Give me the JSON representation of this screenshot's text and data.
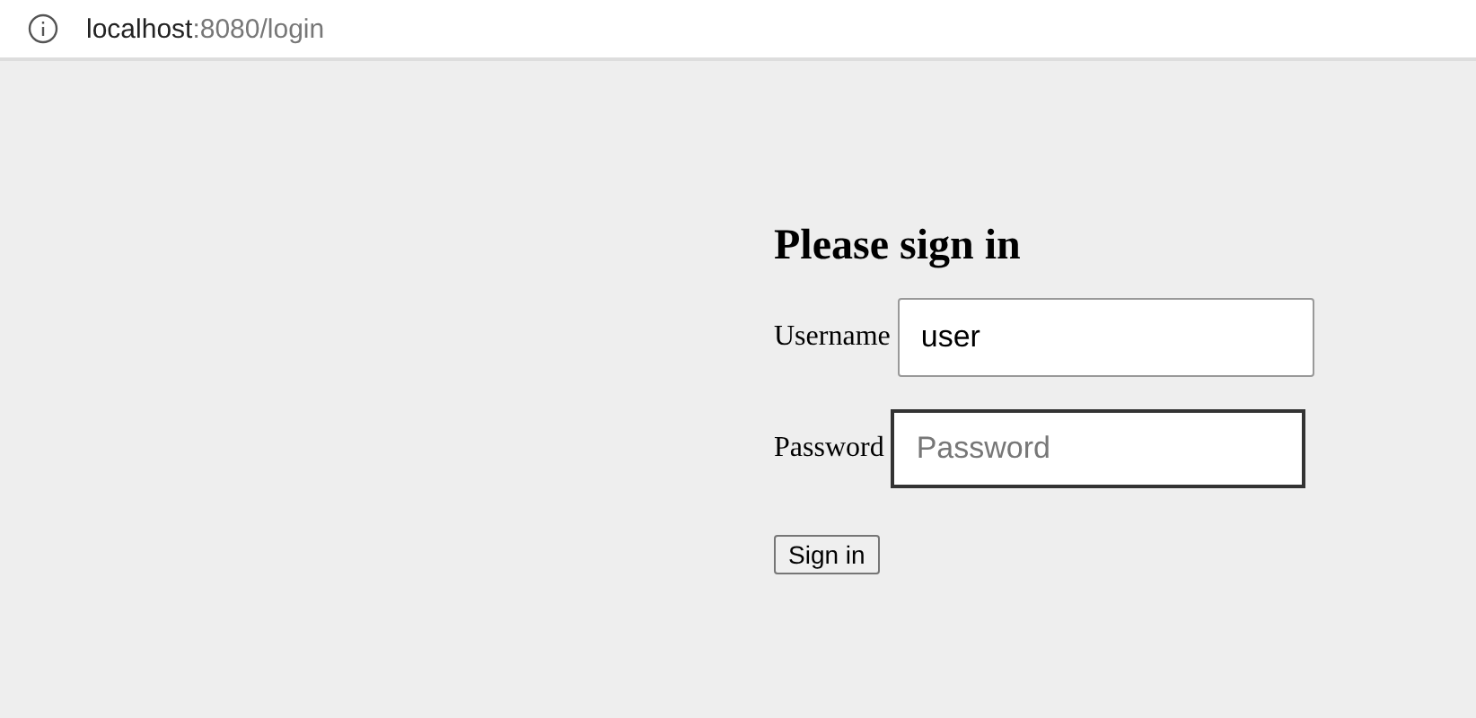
{
  "address_bar": {
    "host": "localhost",
    "path": ":8080/login"
  },
  "form": {
    "title": "Please sign in",
    "fields": [
      {
        "label": "Username",
        "value": "user",
        "focused": false
      },
      {
        "label": "Password",
        "placeholder": "Password",
        "focused": true
      }
    ],
    "submit": "Sign in"
  }
}
